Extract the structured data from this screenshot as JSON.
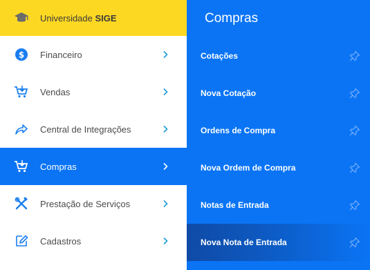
{
  "brand": {
    "prefix": "Universidade ",
    "name": "SIGE",
    "icon": "graduation-cap-icon"
  },
  "menu": [
    {
      "label": "Financeiro",
      "icon": "dollar-circle-icon",
      "active": false
    },
    {
      "label": "Vendas",
      "icon": "cart-add-icon",
      "active": false
    },
    {
      "label": "Central de Integrações",
      "icon": "share-arrow-icon",
      "active": false
    },
    {
      "label": "Compras",
      "icon": "cart-add-icon",
      "active": true
    },
    {
      "label": "Prestação de Serviços",
      "icon": "tools-icon",
      "active": false
    },
    {
      "label": "Cadastros",
      "icon": "edit-icon",
      "active": false
    }
  ],
  "submenu": {
    "title": "Compras",
    "items": [
      {
        "label": "Cotações",
        "highlight": false
      },
      {
        "label": "Nova Cotação",
        "highlight": false
      },
      {
        "label": "Ordens de Compra",
        "highlight": false
      },
      {
        "label": "Nova Ordem de Compra",
        "highlight": false
      },
      {
        "label": "Notas de Entrada",
        "highlight": false
      },
      {
        "label": "Nova Nota de Entrada",
        "highlight": true
      }
    ]
  },
  "colors": {
    "brand_yellow": "#fdd823",
    "primary_blue": "#0a74f5",
    "icon_blue": "#1a7ef0"
  }
}
